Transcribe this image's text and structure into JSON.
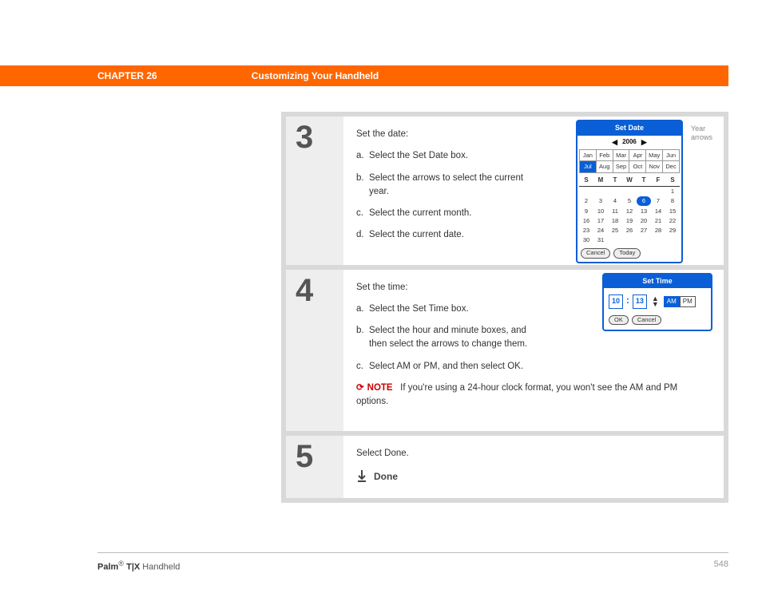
{
  "header": {
    "chapter": "CHAPTER 26",
    "title": "Customizing Your Handheld"
  },
  "footer": {
    "brand_bold": "Palm",
    "brand_reg": "®",
    "brand_model": " T|X",
    "brand_tail": " Handheld",
    "page": "548"
  },
  "step3": {
    "num": "3",
    "intro": "Set the date:",
    "a": "Select the Set Date box.",
    "b": "Select the arrows to select the current year.",
    "c": "Select the current month.",
    "d": "Select the current date.",
    "label_year1": "Year",
    "label_year2": "arrows"
  },
  "step4": {
    "num": "4",
    "intro": "Set the time:",
    "a": "Select the Set Time box.",
    "b": "Select the hour and minute boxes, and then select the arrows to change them.",
    "c": "Select AM or PM, and then select OK.",
    "note_label": "NOTE",
    "note_text": " If you're using a 24-hour clock format, you won't see the AM and PM options."
  },
  "step5": {
    "num": "5",
    "intro": "Select Done.",
    "done": "Done"
  },
  "cal": {
    "title": "Set Date",
    "year": "2006",
    "months": [
      "Jan",
      "Feb",
      "Mar",
      "Apr",
      "May",
      "Jun",
      "Jul",
      "Aug",
      "Sep",
      "Oct",
      "Nov",
      "Dec"
    ],
    "sel_month_index": 6,
    "dow": [
      "S",
      "M",
      "T",
      "W",
      "T",
      "F",
      "S"
    ],
    "days": [
      "",
      "",
      "",
      "",
      "",
      "",
      "1",
      "2",
      "3",
      "4",
      "5",
      "6",
      "7",
      "8",
      "9",
      "10",
      "11",
      "12",
      "13",
      "14",
      "15",
      "16",
      "17",
      "18",
      "19",
      "20",
      "21",
      "22",
      "23",
      "24",
      "25",
      "26",
      "27",
      "28",
      "29",
      "30",
      "31",
      "",
      "",
      "",
      "",
      ""
    ],
    "sel_day_index": 11,
    "btn_cancel": "Cancel",
    "btn_today": "Today"
  },
  "tw": {
    "title": "Set Time",
    "hour": "10",
    "minute": "13",
    "am": "AM",
    "pm": "PM",
    "btn_ok": "OK",
    "btn_cancel": "Cancel"
  }
}
